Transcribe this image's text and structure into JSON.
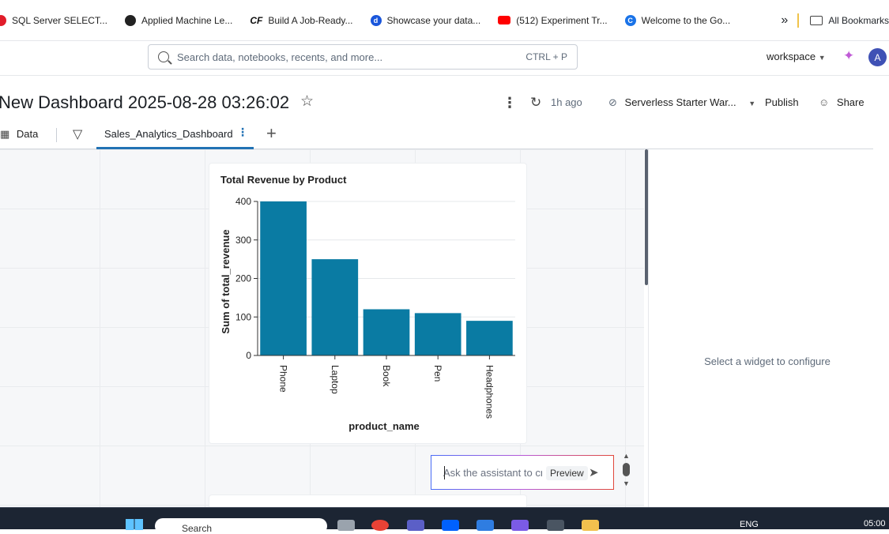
{
  "bookmarks": [
    {
      "label": "SQL Server SELECT...",
      "icon": "red-dot-icon"
    },
    {
      "label": "Applied Machine Le...",
      "icon": "globe-icon"
    },
    {
      "label": "Build A Job-Ready...",
      "icon": "cf-icon",
      "glyph": "CF"
    },
    {
      "label": "Showcase your data...",
      "icon": "d-icon",
      "glyph": "d"
    },
    {
      "label": "(512) Experiment Tr...",
      "icon": "youtube-icon"
    },
    {
      "label": "Welcome to the Go...",
      "icon": "c-icon",
      "glyph": "C"
    }
  ],
  "bookmarks_more": "»",
  "all_bookmarks": "All Bookmarks",
  "search": {
    "placeholder": "Search data, notebooks, recents, and more...",
    "shortcut": "CTRL + P"
  },
  "workspace": {
    "label": "workspace"
  },
  "avatar": {
    "initial": "A"
  },
  "dashboard": {
    "title": "New Dashboard 2025-08-28 03:26:02",
    "refreshed": "1h ago",
    "warehouse": "Serverless Starter War...",
    "publish": "Publish",
    "share": "Share"
  },
  "tabs": {
    "data": "Data",
    "active": "Sales_Analytics_Dashboard"
  },
  "chart_data": {
    "type": "bar",
    "title": "Total Revenue by Product",
    "xlabel": "product_name",
    "ylabel": "Sum of total_revenue",
    "categories": [
      "Phone",
      "Laptop",
      "Book",
      "Pen",
      "Headphones"
    ],
    "values": [
      400,
      250,
      120,
      110,
      90
    ],
    "ylim": [
      0,
      400
    ],
    "yticks": [
      0,
      100,
      200,
      300,
      400
    ],
    "grid": true,
    "color": "#0a7ba3"
  },
  "assistant": {
    "placeholder": "Ask the assistant to create",
    "preview": "Preview"
  },
  "config_panel": {
    "message": "Select a widget to configure"
  },
  "taskbar": {
    "search": "Search",
    "lang": "ENG",
    "time": "05:00"
  }
}
